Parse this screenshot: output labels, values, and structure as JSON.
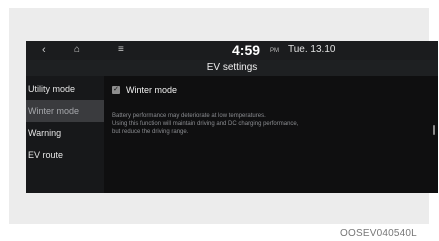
{
  "topbar": {
    "back_icon": "‹",
    "home_icon": "⌂",
    "menu_icon": "≡",
    "time": "4:59",
    "ampm": "PM",
    "date": "Tue. 13.10"
  },
  "title": "EV settings",
  "sidebar": {
    "items": [
      {
        "label": "Utility mode"
      },
      {
        "label": "Winter mode"
      },
      {
        "label": "Warning"
      },
      {
        "label": "EV route"
      }
    ],
    "active_index": 1
  },
  "content": {
    "winter_mode_label": "Winter mode",
    "winter_mode_checked": true,
    "description": [
      "Battery performance may deteriorate at low temperatures.",
      "Using this function will maintain driving and DC charging performance,",
      "but reduce the driving range."
    ]
  },
  "caption": "OOSEV040540L",
  "colors": {
    "screen_bg": "#0f0f10",
    "active_item_bg": "#3a3b3e"
  }
}
